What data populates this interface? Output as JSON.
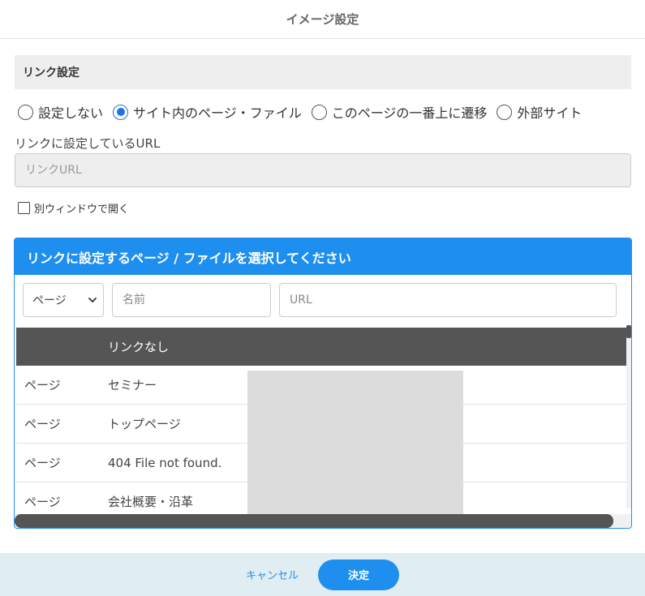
{
  "dialog": {
    "title": "イメージ設定"
  },
  "link_settings": {
    "section_title": "リンク設定",
    "radio_options": [
      {
        "label": "設定しない",
        "checked": false
      },
      {
        "label": "サイト内のページ・ファイル",
        "checked": true
      },
      {
        "label": "このページの一番上に遷移",
        "checked": false
      },
      {
        "label": "外部サイト",
        "checked": false
      }
    ],
    "url_label": "リンクに設定しているURL",
    "url_placeholder": "リンクURL",
    "new_window_label": "別ウィンドウで開く",
    "new_window_checked": false
  },
  "picker": {
    "title": "リンクに設定するページ / ファイルを選択してください",
    "type_select_value": "ページ",
    "name_placeholder": "名前",
    "url_placeholder": "URL",
    "rows": [
      {
        "type": "",
        "name": "リンクなし",
        "selected": true
      },
      {
        "type": "ページ",
        "name": "セミナー"
      },
      {
        "type": "ページ",
        "name": "トップページ"
      },
      {
        "type": "ページ",
        "name": "404 File not found."
      },
      {
        "type": "ページ",
        "name": "会社概要・沿革"
      }
    ]
  },
  "footer": {
    "cancel_label": "キャンセル",
    "ok_label": "決定"
  },
  "colors": {
    "accent": "#1e8fef",
    "header_row": "#555555",
    "footer_bg": "#e0edf2"
  }
}
